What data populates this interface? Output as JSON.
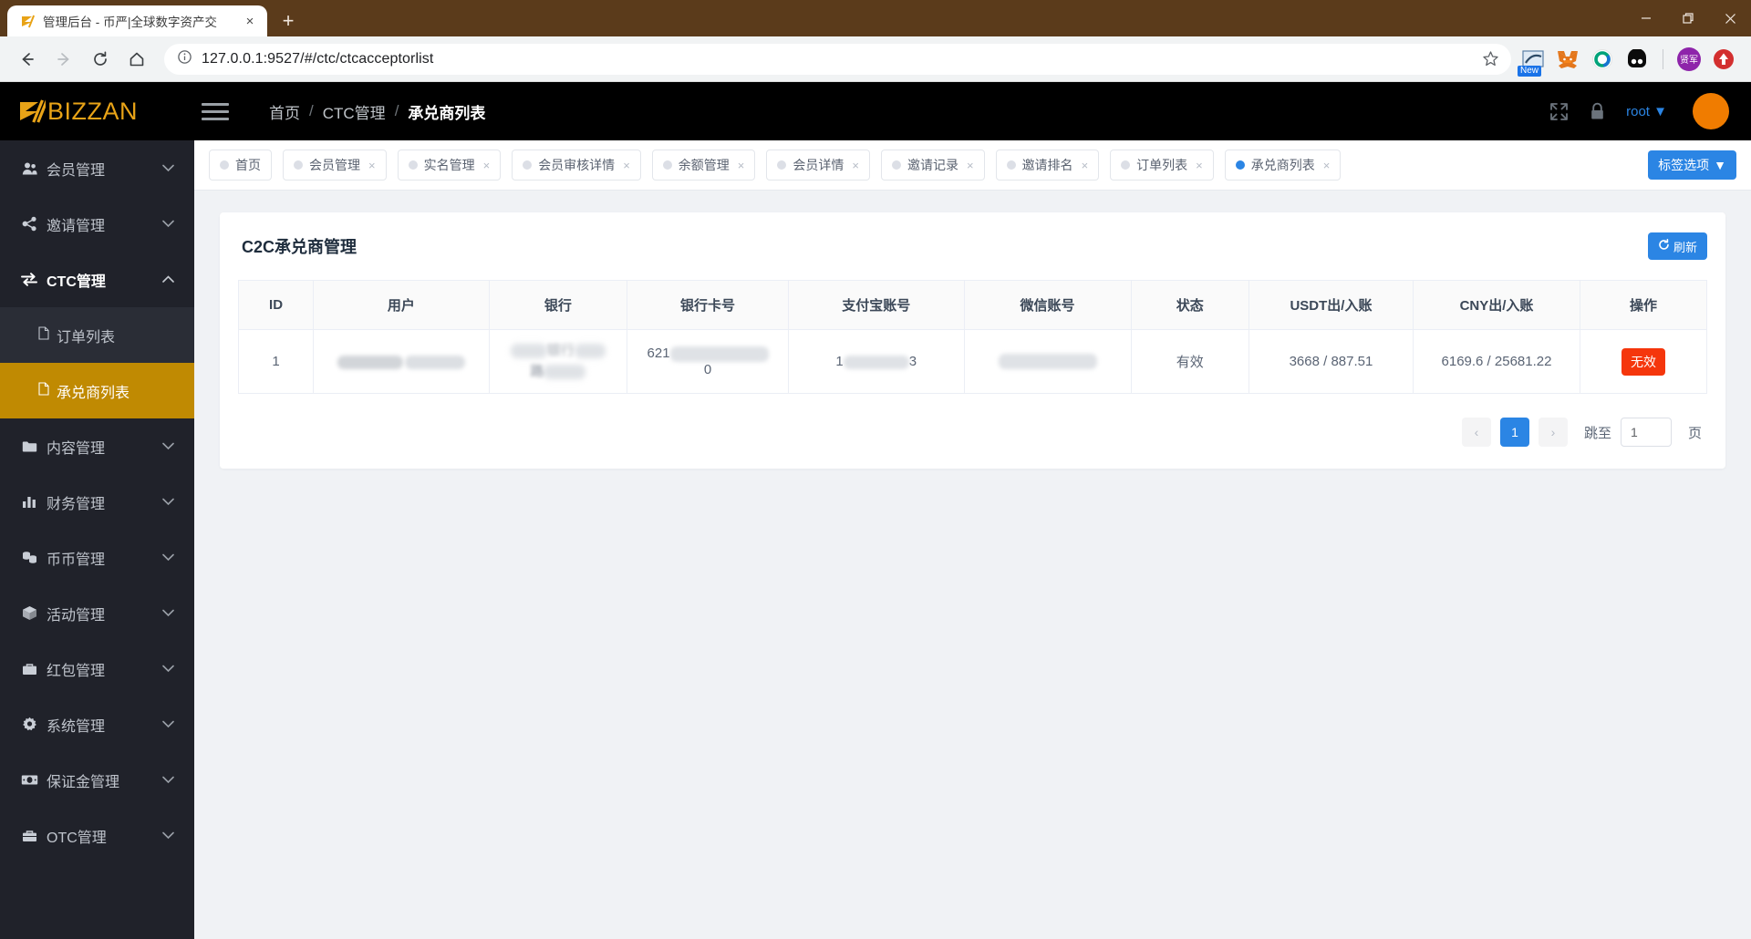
{
  "browser": {
    "tab": {
      "title": "管理后台 - 币严|全球数字资产交",
      "favicon": "bizzan-logo-icon",
      "close": "×"
    },
    "new_tab": "+",
    "window_controls": {
      "minimize": "—",
      "maximize": "❐",
      "close": "✕"
    },
    "nav": {
      "back": "←",
      "forward": "→",
      "reload": "⟳",
      "home": "⌂"
    },
    "address": {
      "scheme_icon": "info-circle-icon",
      "url": "127.0.0.1:9527/#/ctc/ctcacceptorlist",
      "bookmark": "☆"
    },
    "extensions": [
      {
        "name": "screenshot-extension-icon",
        "badge": "New"
      },
      {
        "name": "metamask-extension-icon",
        "badge": ""
      },
      {
        "name": "ring-extension-icon",
        "badge": ""
      },
      {
        "name": "dots-extension-icon",
        "badge": ""
      },
      {
        "name": "user-extension-icon",
        "label": "贤军",
        "color": "#8e24aa"
      },
      {
        "name": "arrow-up-extension-icon",
        "label": "",
        "color": "#d32f2f"
      }
    ]
  },
  "header": {
    "brand": "BIZZAN",
    "brand_logo": "bizzan-logo-icon",
    "menu_toggle": "hamburger-icon",
    "breadcrumb": [
      {
        "label": "首页",
        "current": false
      },
      {
        "label": "CTC管理",
        "current": false
      },
      {
        "label": "承兑商列表",
        "current": true
      }
    ],
    "separator": "/",
    "fullscreen_icon": "fullscreen-icon",
    "lock_icon": "lock-icon",
    "user": "root",
    "user_caret": "▼",
    "avatar": "user-avatar",
    "accent_color": "#e8a317",
    "bar_color": "#000000"
  },
  "sidebar": {
    "items": [
      {
        "label": "会员管理",
        "icon": "users-icon",
        "arrow": "chevron-down",
        "expanded": false
      },
      {
        "label": "邀请管理",
        "icon": "share-icon",
        "arrow": "chevron-down",
        "expanded": false
      },
      {
        "label": "CTC管理",
        "icon": "exchange-icon",
        "arrow": "chevron-up",
        "expanded": true
      },
      {
        "label": "内容管理",
        "icon": "folder-icon",
        "arrow": "chevron-down",
        "expanded": false
      },
      {
        "label": "财务管理",
        "icon": "chart-icon",
        "arrow": "chevron-down",
        "expanded": false
      },
      {
        "label": "币币管理",
        "icon": "coins-icon",
        "arrow": "chevron-down",
        "expanded": false
      },
      {
        "label": "活动管理",
        "icon": "box-icon",
        "arrow": "chevron-down",
        "expanded": false
      },
      {
        "label": "红包管理",
        "icon": "briefcase-icon",
        "arrow": "chevron-down",
        "expanded": false
      },
      {
        "label": "系统管理",
        "icon": "gear-icon",
        "arrow": "chevron-down",
        "expanded": false
      },
      {
        "label": "保证金管理",
        "icon": "money-icon",
        "arrow": "chevron-down",
        "expanded": false
      },
      {
        "label": "OTC管理",
        "icon": "suitcase-icon",
        "arrow": "chevron-down",
        "expanded": false
      }
    ],
    "submenu": [
      {
        "label": "订单列表",
        "icon": "file-icon",
        "active": false
      },
      {
        "label": "承兑商列表",
        "icon": "file-icon",
        "active": true
      }
    ],
    "active_color": "#c08a02",
    "background": "#20222a"
  },
  "tags_bar": {
    "tags": [
      {
        "label": "首页",
        "active": false,
        "closable": false
      },
      {
        "label": "会员管理",
        "active": false,
        "closable": true
      },
      {
        "label": "实名管理",
        "active": false,
        "closable": true
      },
      {
        "label": "会员审核详情",
        "active": false,
        "closable": true
      },
      {
        "label": "余额管理",
        "active": false,
        "closable": true
      },
      {
        "label": "会员详情",
        "active": false,
        "closable": true
      },
      {
        "label": "邀请记录",
        "active": false,
        "closable": true
      },
      {
        "label": "邀请排名",
        "active": false,
        "closable": true
      },
      {
        "label": "订单列表",
        "active": false,
        "closable": true
      },
      {
        "label": "承兑商列表",
        "active": true,
        "closable": true
      }
    ],
    "close_glyph": "×",
    "options_button": {
      "label": "标签选项",
      "caret": "▼"
    }
  },
  "card": {
    "title": "C2C承兑商管理",
    "refresh_button": {
      "label": "刷新",
      "icon": "refresh-icon"
    },
    "table": {
      "columns": [
        "ID",
        "用户",
        "银行",
        "银行卡号",
        "支付宝账号",
        "微信账号",
        "状态",
        "USDT出/入账",
        "CNY出/入账",
        "操作"
      ],
      "rows": [
        {
          "id": "1",
          "user": "",
          "bank_line1": "银行",
          "bank_line2": "路",
          "bank_card_prefix": "621",
          "bank_card_suffix": "0",
          "alipay_prefix": "1",
          "alipay_suffix": "3",
          "wechat": "",
          "status": "有效",
          "usdt": "3668 / 887.51",
          "cny": "6169.6 / 25681.22",
          "action": "无效"
        }
      ]
    },
    "pagination": {
      "prev": "‹",
      "next": "›",
      "pages": [
        "1"
      ],
      "current_page": "1",
      "jump_label": "跳至",
      "jump_value": "1",
      "page_suffix": "页"
    }
  }
}
